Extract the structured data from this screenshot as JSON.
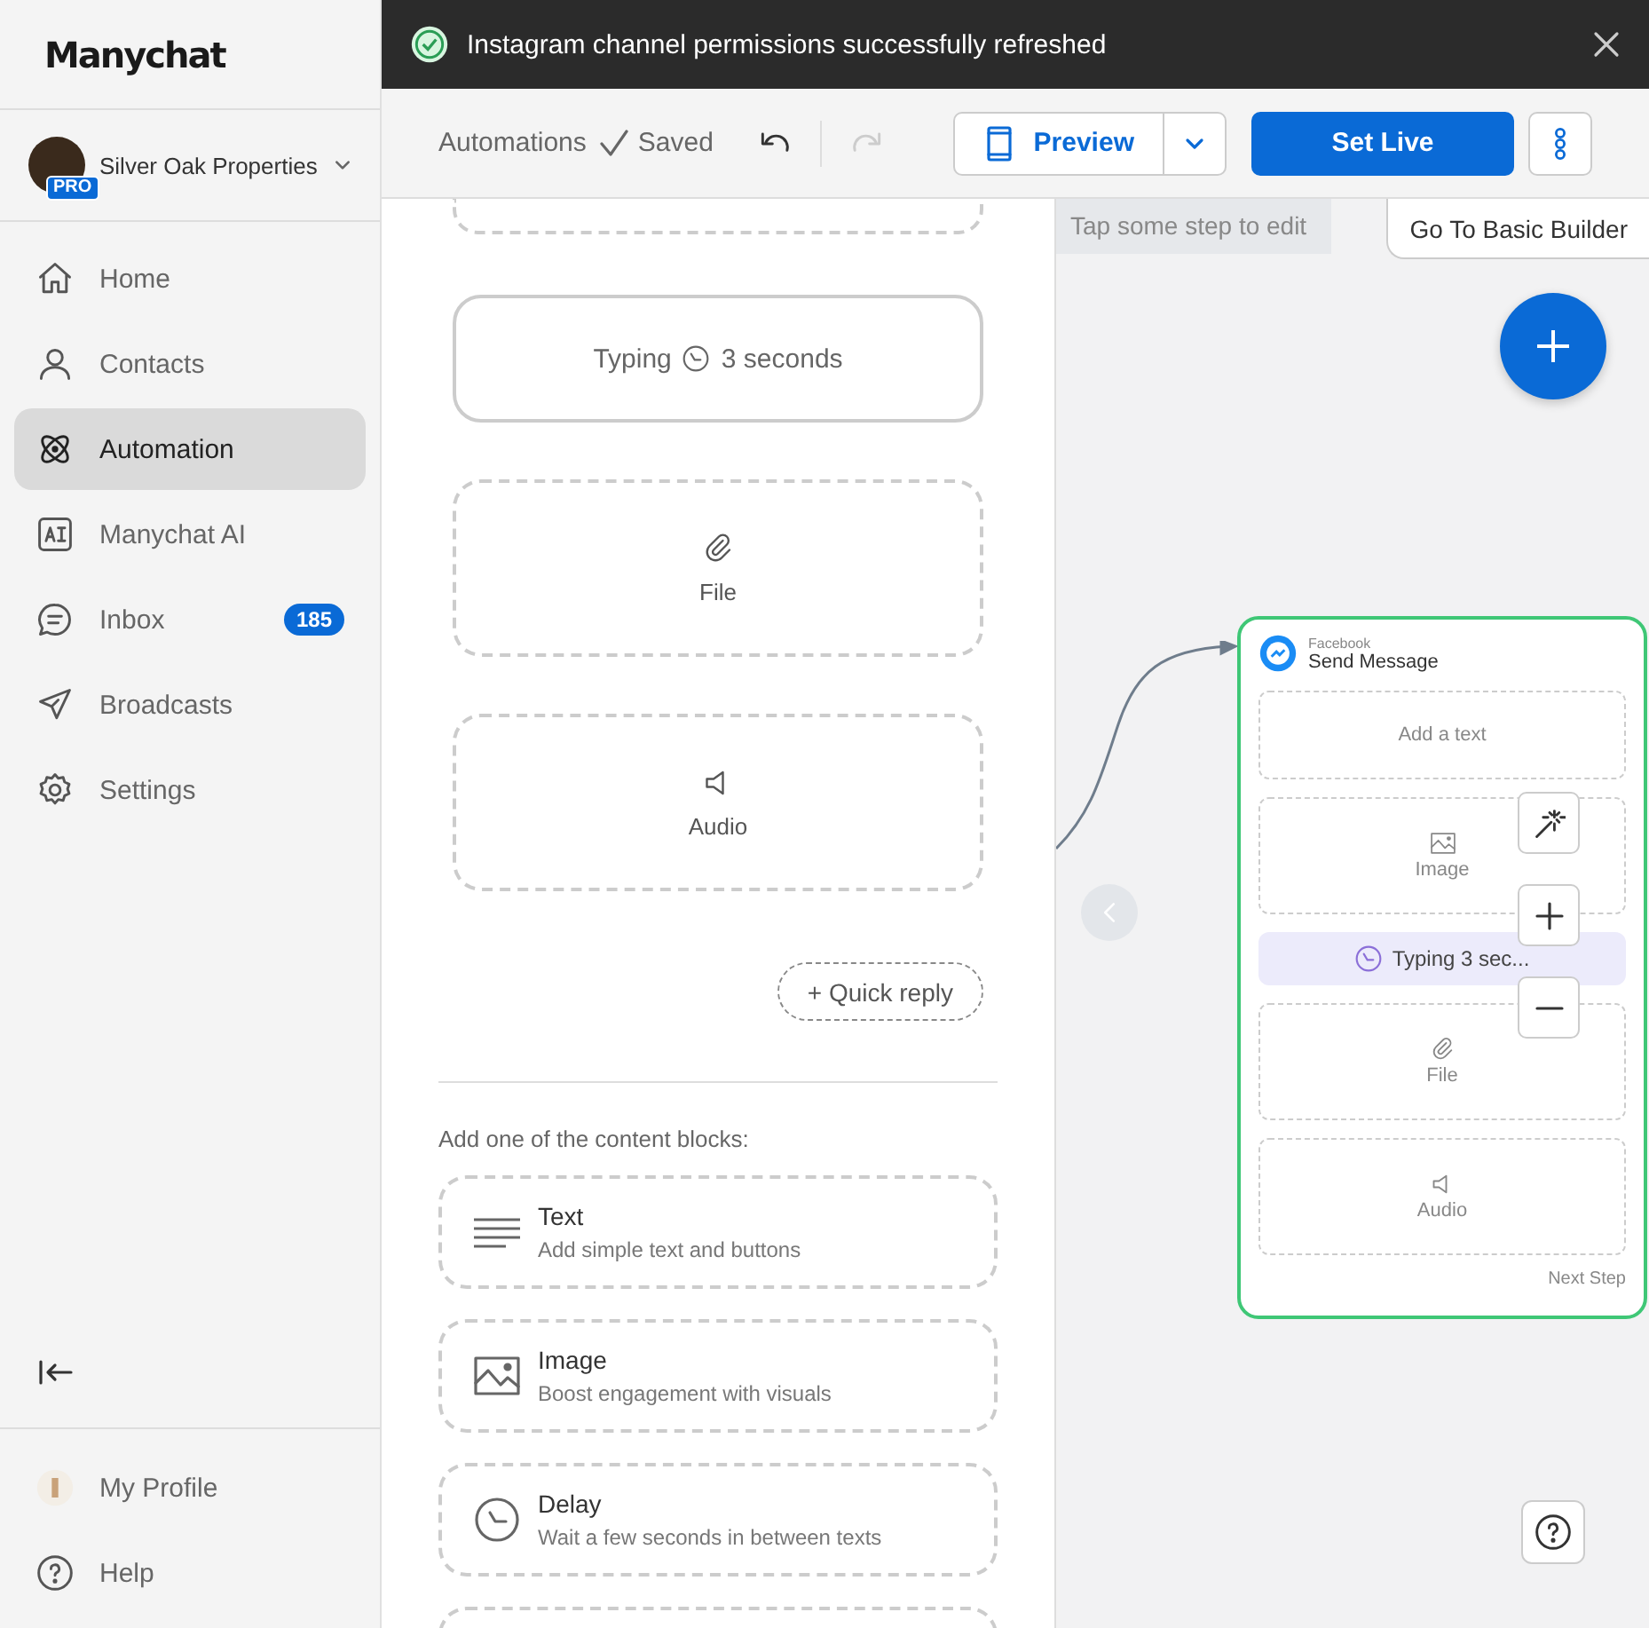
{
  "sidebar": {
    "logo": "Manychat",
    "account": {
      "name": "Silver Oak Properties",
      "badge": "PRO"
    },
    "items": [
      {
        "label": "Home",
        "selected": false
      },
      {
        "label": "Contacts",
        "selected": false
      },
      {
        "label": "Automation",
        "selected": true
      },
      {
        "label": "Manychat AI",
        "selected": false
      },
      {
        "label": "Inbox",
        "badge": "185",
        "selected": false
      },
      {
        "label": "Broadcasts",
        "selected": false
      },
      {
        "label": "Settings",
        "selected": false
      }
    ],
    "footer_items": [
      {
        "label": "My Profile"
      },
      {
        "label": "Help"
      }
    ]
  },
  "toast": {
    "message": "Instagram channel permissions successfully refreshed"
  },
  "toolbar": {
    "breadcrumb": "Automations",
    "save_status": "Saved",
    "history": [
      {
        "kind": "undo",
        "disabled": false
      },
      {
        "kind": "redo",
        "disabled": true
      }
    ],
    "preview": "Preview",
    "set_live": "Set Live"
  },
  "editor": {
    "blocks": [
      {
        "kind": "typing",
        "label": "Typing",
        "duration": "3 seconds"
      },
      {
        "kind": "file",
        "label": "File"
      },
      {
        "kind": "audio",
        "label": "Audio"
      }
    ],
    "quick_reply": "+ Quick reply",
    "add_heading": "Add one of the content blocks:",
    "content_blocks": [
      {
        "kind": "text",
        "title": "Text",
        "description": "Add simple text and buttons"
      },
      {
        "kind": "image",
        "title": "Image",
        "description": "Boost engagement with visuals"
      },
      {
        "kind": "delay",
        "title": "Delay",
        "description": "Wait a few seconds in between texts"
      }
    ]
  },
  "canvas": {
    "hint": "Tap some step to edit",
    "basic_builder": "Go To Basic Builder",
    "node": {
      "channel": "Facebook",
      "title": "Send Message",
      "blocks": [
        {
          "kind": "text",
          "label": "Add a text"
        },
        {
          "kind": "image",
          "label": "Image"
        },
        {
          "kind": "typing",
          "label": "Typing 3 sec..."
        },
        {
          "kind": "file",
          "label": "File"
        },
        {
          "kind": "audio",
          "label": "Audio"
        }
      ],
      "next_step": "Next Step"
    }
  }
}
